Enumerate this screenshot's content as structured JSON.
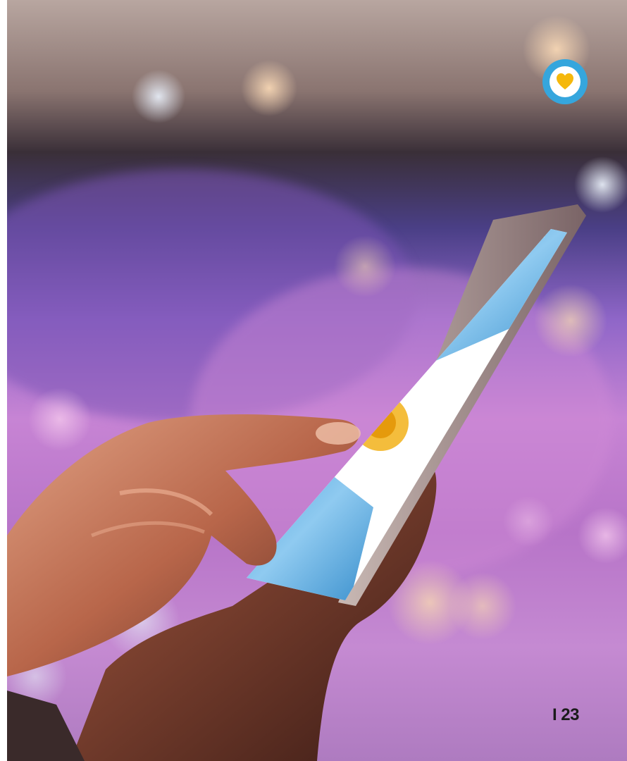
{
  "page": {
    "number_label": "I 23"
  },
  "badge": {
    "icon": "heart-icon",
    "ring_color": "#35a6dd",
    "heart_color": "#f5b80c"
  },
  "photo": {
    "subject": "hands-holding-smartphone",
    "screen_content": "argentina-flag",
    "flag_colors": [
      "#74b7e0",
      "#ffffff",
      "#f2b21a"
    ]
  }
}
